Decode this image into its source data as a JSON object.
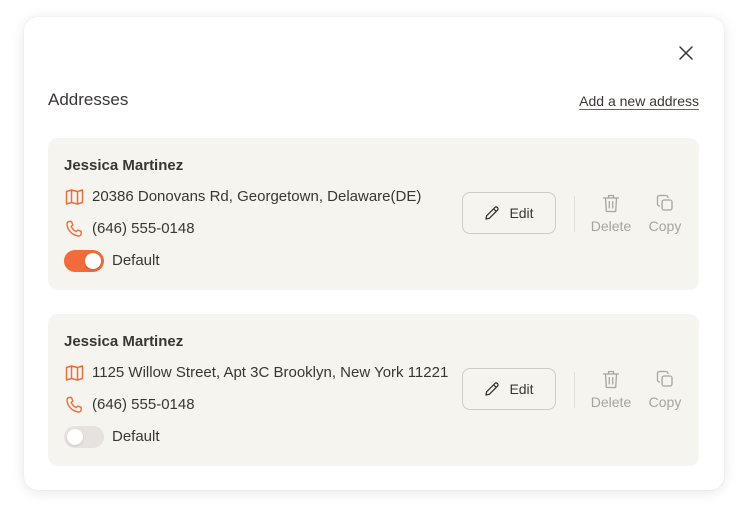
{
  "dialog": {
    "title": "Addresses",
    "add_link": "Add a new address"
  },
  "addresses": [
    {
      "name": "Jessica Martinez",
      "address": "20386 Donovans Rd, Georgetown, Delaware(DE)",
      "phone": "(646) 555-0148",
      "default_label": "Default",
      "is_default": true,
      "edit_label": "Edit",
      "delete_label": "Delete",
      "copy_label": "Copy"
    },
    {
      "name": "Jessica Martinez",
      "address": "1125 Willow Street, Apt 3C Brooklyn, New York 11221",
      "phone": "(646) 555-0148",
      "default_label": "Default",
      "is_default": false,
      "edit_label": "Edit",
      "delete_label": "Delete",
      "copy_label": "Copy"
    }
  ],
  "icons": {
    "close": "close-icon",
    "address": "map-icon",
    "phone": "phone-icon",
    "edit": "pencil-icon",
    "delete": "trash-icon",
    "copy": "copy-icon"
  },
  "colors": {
    "accent": "#f26b3a",
    "card_bg": "#f6f4ef",
    "muted_text": "#a8a49e"
  }
}
